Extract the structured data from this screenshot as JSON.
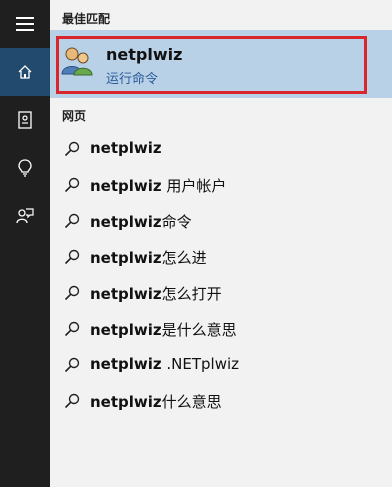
{
  "best_match": {
    "section_title": "最佳匹配",
    "name": "netplwiz",
    "subtitle": "运行命令"
  },
  "web": {
    "section_title": "网页",
    "results": [
      {
        "bold": "netplwiz",
        "rest": ""
      },
      {
        "bold": "netplwiz",
        "rest": " 用户帐户"
      },
      {
        "bold": "netplwiz",
        "rest": "命令"
      },
      {
        "bold": "netplwiz",
        "rest": "怎么进"
      },
      {
        "bold": "netplwiz",
        "rest": "怎么打开"
      },
      {
        "bold": "netplwiz",
        "rest": "是什么意思"
      },
      {
        "bold": "netplwiz",
        "rest": " .NETplwiz"
      },
      {
        "bold": "netplwiz",
        "rest": "什么意思"
      }
    ]
  },
  "sidebar": {
    "items": [
      "menu-icon",
      "home-icon",
      "notebook-icon",
      "lightbulb-icon",
      "feedback-icon"
    ]
  },
  "colors": {
    "rail": "#1f1f1f",
    "active": "#214a6e",
    "highlight": "#b9d1e6",
    "outline": "#d8262b"
  }
}
